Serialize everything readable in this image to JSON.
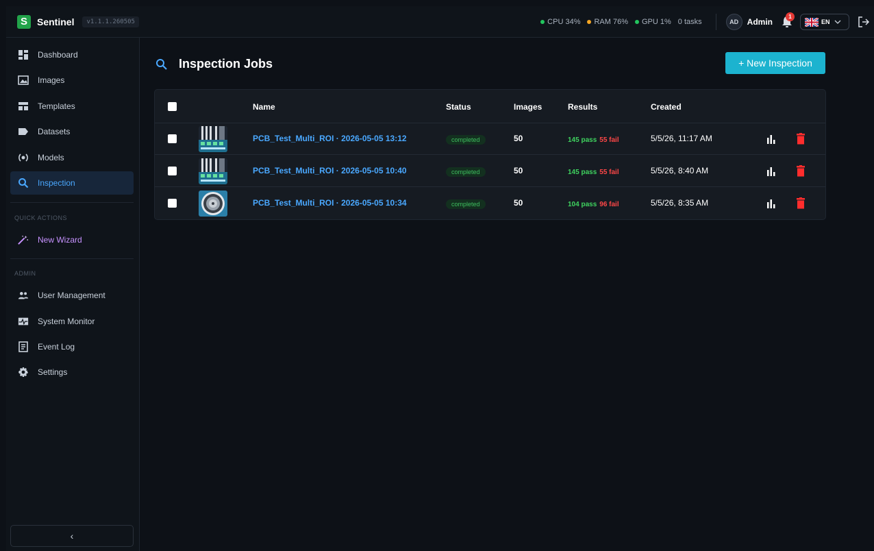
{
  "app": {
    "logo_letter": "S",
    "name": "Sentinel",
    "version": "v1.1.1.260505"
  },
  "stats": [
    {
      "label": "CPU 34%",
      "color": "#22c55e"
    },
    {
      "label": "RAM 76%",
      "color": "#f5a623"
    },
    {
      "label": "GPU 1%",
      "color": "#22c55e"
    }
  ],
  "tasks": "0 tasks",
  "user": {
    "initials": "AD",
    "name": "Admin"
  },
  "notifications": {
    "count": "1"
  },
  "language": {
    "code": "EN"
  },
  "sidebar": {
    "items": [
      {
        "label": "Dashboard",
        "icon": "dashboard-icon"
      },
      {
        "label": "Images",
        "icon": "images-icon"
      },
      {
        "label": "Templates",
        "icon": "templates-icon"
      },
      {
        "label": "Datasets",
        "icon": "datasets-icon"
      },
      {
        "label": "Models",
        "icon": "models-icon"
      },
      {
        "label": "Inspection",
        "icon": "search-icon",
        "active": true
      }
    ],
    "quick_actions_title": "QUICK ACTIONS",
    "quick_actions": [
      {
        "label": "New Wizard",
        "icon": "magic-wand-icon"
      }
    ],
    "admin_title": "ADMIN",
    "admin_items": [
      {
        "label": "User Management",
        "icon": "users-icon"
      },
      {
        "label": "System Monitor",
        "icon": "monitor-icon"
      },
      {
        "label": "Event Log",
        "icon": "log-icon"
      },
      {
        "label": "Settings",
        "icon": "gear-icon"
      }
    ],
    "collapse_label": "‹"
  },
  "main": {
    "title": "Inspection Jobs",
    "new_button": "+ New Inspection",
    "columns": {
      "name": "Name",
      "status": "Status",
      "images": "Images",
      "results": "Results",
      "created": "Created"
    },
    "jobs": [
      {
        "name": "PCB_Test_Multi_ROI · 2026-05-05 13:12",
        "status": "completed",
        "images": "50",
        "pass": "145 pass",
        "fail": "55 fail",
        "created": "5/5/26, 11:17 AM",
        "thumb": "pcb"
      },
      {
        "name": "PCB_Test_Multi_ROI · 2026-05-05 10:40",
        "status": "completed",
        "images": "50",
        "pass": "145 pass",
        "fail": "55 fail",
        "created": "5/5/26, 8:40 AM",
        "thumb": "pcb"
      },
      {
        "name": "PCB_Test_Multi_ROI · 2026-05-05 10:34",
        "status": "completed",
        "images": "50",
        "pass": "104 pass",
        "fail": "96 fail",
        "created": "5/5/26, 8:35 AM",
        "thumb": "disc"
      }
    ]
  }
}
